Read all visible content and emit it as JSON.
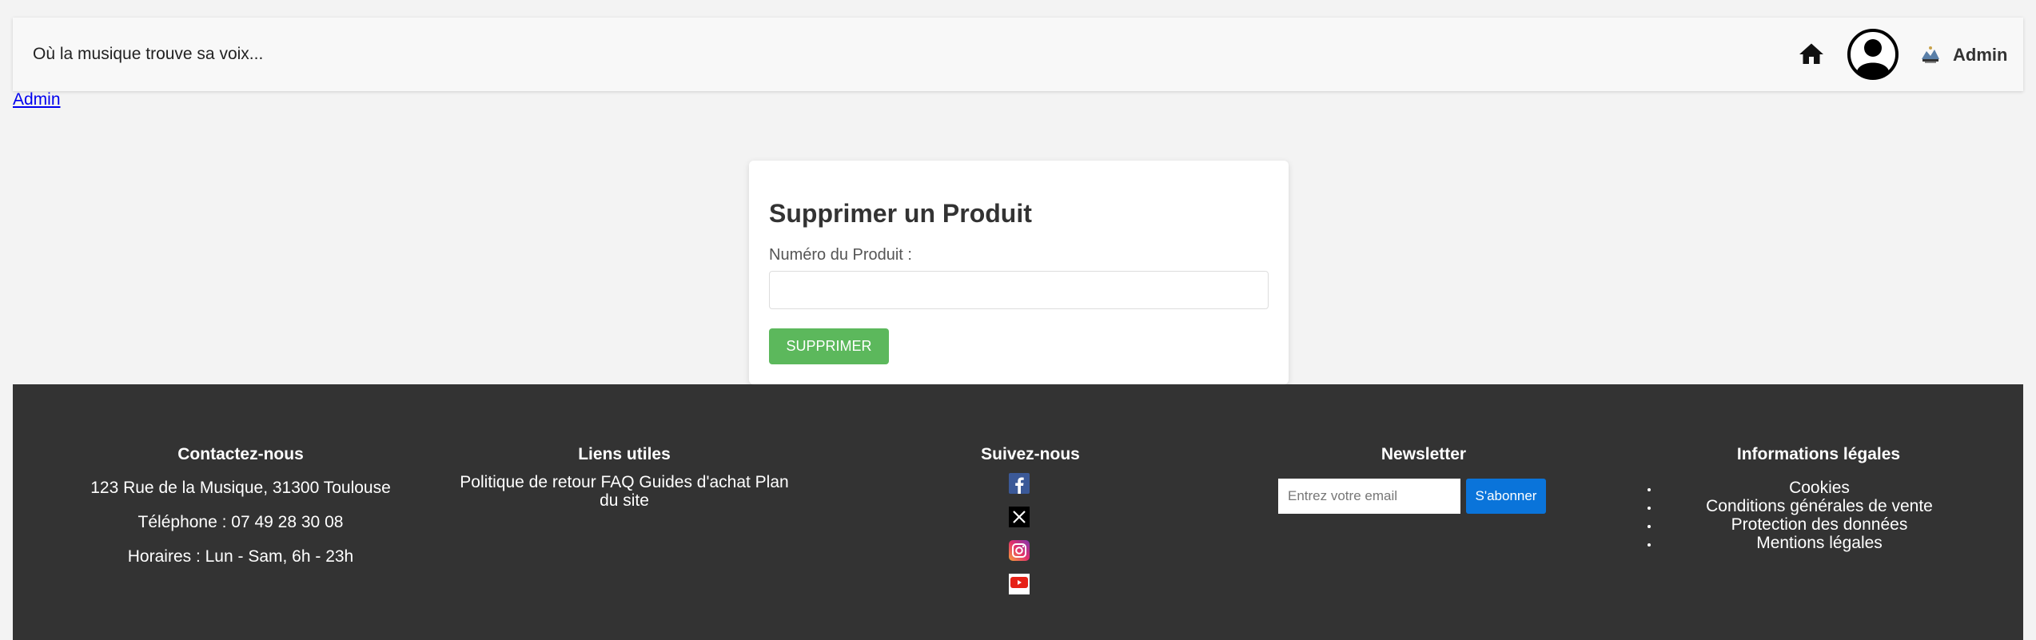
{
  "header": {
    "tagline": "Où la musique trouve sa voix...",
    "admin_name": "Admin"
  },
  "admin_link": "Admin",
  "form": {
    "title": "Supprimer un Produit",
    "label": "Numéro du Produit :",
    "input_value": "",
    "button_label": "SUPPRIMER"
  },
  "footer": {
    "contact": {
      "title": "Contactez-nous",
      "address": "123 Rue de la Musique, 31300 Toulouse",
      "phone": "Téléphone : 07 49 28 30 08",
      "hours": "Horaires : Lun - Sam, 6h - 23h"
    },
    "links": {
      "title": "Liens utiles",
      "text": "Politique de retour FAQ Guides d'achat Plan du site"
    },
    "social": {
      "title": "Suivez-nous",
      "icons": [
        "facebook-icon",
        "x-icon",
        "instagram-icon",
        "youtube-icon"
      ]
    },
    "newsletter": {
      "title": "Newsletter",
      "placeholder": "Entrez votre email",
      "button_label": "S'abonner"
    },
    "legal": {
      "title": "Informations légales",
      "items": [
        "Cookies",
        "Conditions générales de vente",
        "Protection des données",
        "Mentions légales"
      ]
    }
  },
  "colors": {
    "page_bg": "#f3f3f3",
    "footer_bg": "#333333",
    "delete_button": "#5cb85c",
    "subscribe_button": "#0a74da",
    "link": "#0000ee"
  }
}
